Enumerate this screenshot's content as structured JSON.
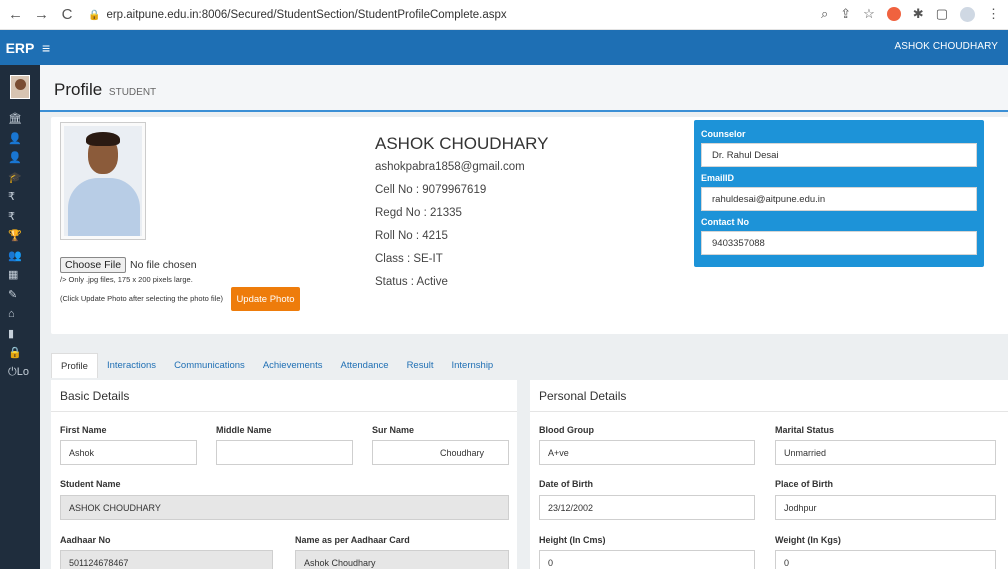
{
  "browser": {
    "url": "erp.aitpune.edu.in:8006/Secured/StudentSection/StudentProfileComplete.aspx"
  },
  "topbar": {
    "brand": "ERP",
    "user_name": "ASHOK CHOUDHARY"
  },
  "sidebar": {
    "items": [
      {
        "icon": "bank-icon",
        "glyph": "🏛"
      },
      {
        "icon": "user-icon",
        "glyph": "👤"
      },
      {
        "icon": "user-alt-icon",
        "glyph": "👤"
      },
      {
        "icon": "graduation-cap-icon",
        "glyph": "🎓"
      },
      {
        "icon": "rupee-icon",
        "glyph": "₹"
      },
      {
        "icon": "rupee-alt-icon",
        "glyph": "₹"
      },
      {
        "icon": "trophy-icon",
        "glyph": "🏆"
      },
      {
        "icon": "users-icon",
        "glyph": "👥"
      },
      {
        "icon": "id-card-icon",
        "glyph": "▦"
      },
      {
        "icon": "edit-icon",
        "glyph": "✎"
      },
      {
        "icon": "home-icon",
        "glyph": "⌂"
      },
      {
        "icon": "book-icon",
        "glyph": "▮"
      },
      {
        "icon": "lock-icon",
        "glyph": "🔒"
      }
    ],
    "logout_label": "Lo"
  },
  "page": {
    "title": "Profile",
    "subtitle": "STUDENT"
  },
  "profile": {
    "file_button": "Choose File",
    "file_status": "No file chosen",
    "hint_size": "/> Only .jpg files, 175 x 200 pixels large.",
    "hint_click": "(Click Update Photo after selecting the photo file)",
    "update_button": "Update Photo",
    "name": "ASHOK CHOUDHARY",
    "email": "ashokpabra1858@gmail.com",
    "cell": "Cell No : 9079967619",
    "regd": "Regd No : 21335",
    "roll": "Roll No : 4215",
    "class": "Class : SE-IT",
    "status": "Status : Active"
  },
  "counselor": {
    "label_counselor": "Counselor",
    "counselor_name": "Dr. Rahul Desai",
    "label_email": "EmailID",
    "email": "rahuldesai@aitpune.edu.in",
    "label_contact": "Contact No",
    "contact": "9403357088"
  },
  "tabs": [
    "Profile",
    "Interactions",
    "Communications",
    "Achievements",
    "Attendance",
    "Result",
    "Internship"
  ],
  "basic": {
    "heading": "Basic Details",
    "first_name_label": "First Name",
    "first_name": "Ashok",
    "middle_name_label": "Middle Name",
    "middle_name": "",
    "sur_name_label": "Sur Name",
    "sur_name": "Choudhary",
    "student_name_label": "Student Name",
    "student_name": "ASHOK CHOUDHARY",
    "aadhaar_label": "Aadhaar No",
    "aadhaar": "501124678467",
    "aadhaar_name_label": "Name as per Aadhaar Card",
    "aadhaar_name": "Ashok Choudhary"
  },
  "personal": {
    "heading": "Personal Details",
    "blood_group_label": "Blood Group",
    "blood_group": "A+ve",
    "marital_label": "Marital Status",
    "marital": "Unmarried",
    "dob_label": "Date of Birth",
    "dob": "23/12/2002",
    "pob_label": "Place of Birth",
    "pob": "Jodhpur",
    "height_label": "Height (In Cms)",
    "height": "0",
    "weight_label": "Weight (In Kgs)",
    "weight": "0"
  }
}
